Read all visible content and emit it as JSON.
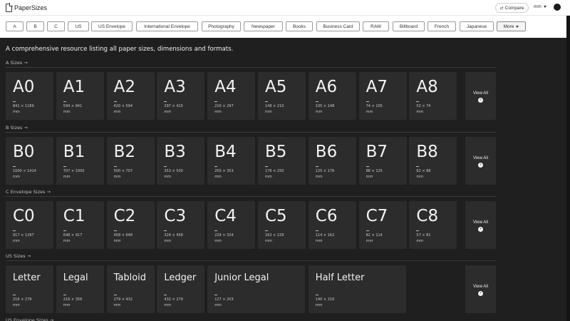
{
  "header": {
    "logo_text": "PaperSizes",
    "compare_label": "Compare",
    "unit_label": "mm"
  },
  "categories": [
    "A",
    "B",
    "C",
    "US",
    "US Envelope",
    "International Envelope",
    "Photography",
    "Newspaper",
    "Books",
    "Business Card",
    "RAW",
    "Billboard",
    "French",
    "Japanese"
  ],
  "more_label": "More",
  "tagline": "A comprehensive resource listing all paper sizes, dimensions and formats.",
  "view_all_label": "View All",
  "sections": [
    {
      "title": "A Sizes →",
      "cards": [
        {
          "name": "A0",
          "dim": "841 × 1189",
          "unit": "mm"
        },
        {
          "name": "A1",
          "dim": "594 × 841",
          "unit": "mm"
        },
        {
          "name": "A2",
          "dim": "420 × 594",
          "unit": "mm"
        },
        {
          "name": "A3",
          "dim": "297 × 420",
          "unit": "mm"
        },
        {
          "name": "A4",
          "dim": "210 × 297",
          "unit": "mm"
        },
        {
          "name": "A5",
          "dim": "148 × 210",
          "unit": "mm"
        },
        {
          "name": "A6",
          "dim": "105 × 148",
          "unit": "mm"
        },
        {
          "name": "A7",
          "dim": "74 × 105",
          "unit": "mm"
        },
        {
          "name": "A8",
          "dim": "52 × 74",
          "unit": "mm"
        }
      ]
    },
    {
      "title": "B Sizes →",
      "cards": [
        {
          "name": "B0",
          "dim": "1000 × 1414",
          "unit": "mm"
        },
        {
          "name": "B1",
          "dim": "707 × 1000",
          "unit": "mm"
        },
        {
          "name": "B2",
          "dim": "500 × 707",
          "unit": "mm"
        },
        {
          "name": "B3",
          "dim": "353 × 500",
          "unit": "mm"
        },
        {
          "name": "B4",
          "dim": "250 × 353",
          "unit": "mm"
        },
        {
          "name": "B5",
          "dim": "176 × 250",
          "unit": "mm"
        },
        {
          "name": "B6",
          "dim": "125 × 176",
          "unit": "mm"
        },
        {
          "name": "B7",
          "dim": "88 × 125",
          "unit": "mm"
        },
        {
          "name": "B8",
          "dim": "62 × 88",
          "unit": "mm"
        }
      ]
    },
    {
      "title": "C Envelope Sizes →",
      "cards": [
        {
          "name": "C0",
          "dim": "917 × 1297",
          "unit": "mm"
        },
        {
          "name": "C1",
          "dim": "648 × 917",
          "unit": "mm"
        },
        {
          "name": "C2",
          "dim": "458 × 648",
          "unit": "mm"
        },
        {
          "name": "C3",
          "dim": "324 × 458",
          "unit": "mm"
        },
        {
          "name": "C4",
          "dim": "229 × 324",
          "unit": "mm"
        },
        {
          "name": "C5",
          "dim": "162 × 229",
          "unit": "mm"
        },
        {
          "name": "C6",
          "dim": "114 × 162",
          "unit": "mm"
        },
        {
          "name": "C7",
          "dim": "81 × 114",
          "unit": "mm"
        },
        {
          "name": "C8",
          "dim": "57 × 81",
          "unit": "mm"
        }
      ]
    },
    {
      "title": "US Sizes →",
      "cards": [
        {
          "name": "Letter",
          "dim": "216 × 279",
          "unit": "mm"
        },
        {
          "name": "Legal",
          "dim": "216 × 356",
          "unit": "mm"
        },
        {
          "name": "Tabloid",
          "dim": "279 × 432",
          "unit": "mm"
        },
        {
          "name": "Ledger",
          "dim": "432 × 279",
          "unit": "mm"
        },
        {
          "name": "Junior Legal",
          "dim": "127 × 203",
          "unit": "mm"
        },
        {
          "name": "Half Letter",
          "dim": "140 × 216",
          "unit": "mm"
        }
      ]
    },
    {
      "title": "US Envelope Sizes →",
      "cards": []
    }
  ]
}
